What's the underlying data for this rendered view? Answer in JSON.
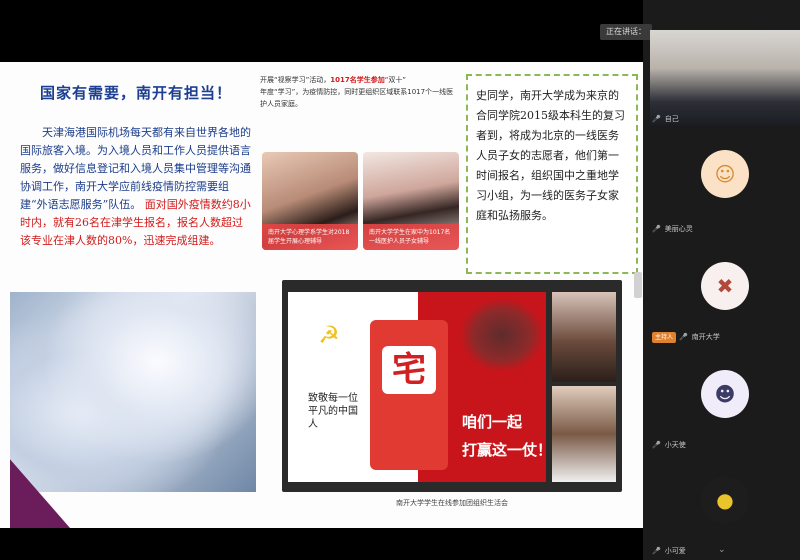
{
  "slide": {
    "headline": "国家有需要，南开有担当！",
    "body_part1": "天津海港国际机场每天都有来自世界各地的国际旅客入境。为入境人员和工作人员提供语言服务，做好信息登记和入境人员集中管理等沟通协调工作，南开大学应前线疫情防控需要组建“外语志愿服务”队伍。",
    "body_highlight": "面对国外疫情数约8小时内，就有26名在津学生报名，报名人数超过该专业在津人数的80%，迅速完成组建。",
    "topnote_text": "开展“视察学习”活动，",
    "topnote_red": "1017名学生参加",
    "topnote_rest": "“双十”",
    "topnote_line2": "年度“学习”，为疫情防控，同时更组织区域联系1017个一线医护人员家庭。",
    "photo1_caption": "南开大学心理学系学生对2018届学生开展心理辅导",
    "photo2_caption": "南开大学学生在家中为1017名一线医护人员子女辅导",
    "quote": "史同学，南开大学成为来京的合同学院2015级本科生的复习者到，将成为北京的一线医务人员子女的志愿者，他们第一时间报名，组织国中之重地学习小组，为一线的医务子女家庭和弘扬服务。",
    "embed_left_text": "致敬每一位平凡的中国人",
    "embed_zhai": "宅",
    "embed_slogan_1": "咱们一起",
    "embed_slogan_2": "打赢这一仗！",
    "embed_caption": "南开大学学生在线参加团组织生活会",
    "party_icon": "☭"
  },
  "sidebar": {
    "meeting_tag": "正在讲话：",
    "tiles": [
      {
        "label": "自己",
        "icon": "user-video"
      },
      {
        "label": "美丽心灵",
        "icon": "avatar-cartoon-girl"
      },
      {
        "label": "南开大学 ",
        "badge": "主持人",
        "icon": "avatar-red-mark"
      },
      {
        "label": "小天使",
        "icon": "avatar-purple-girl"
      },
      {
        "label": "小可爱",
        "icon": "avatar-yellow-duck"
      }
    ],
    "mic_icon": "🎤",
    "chevron": "⌄"
  }
}
